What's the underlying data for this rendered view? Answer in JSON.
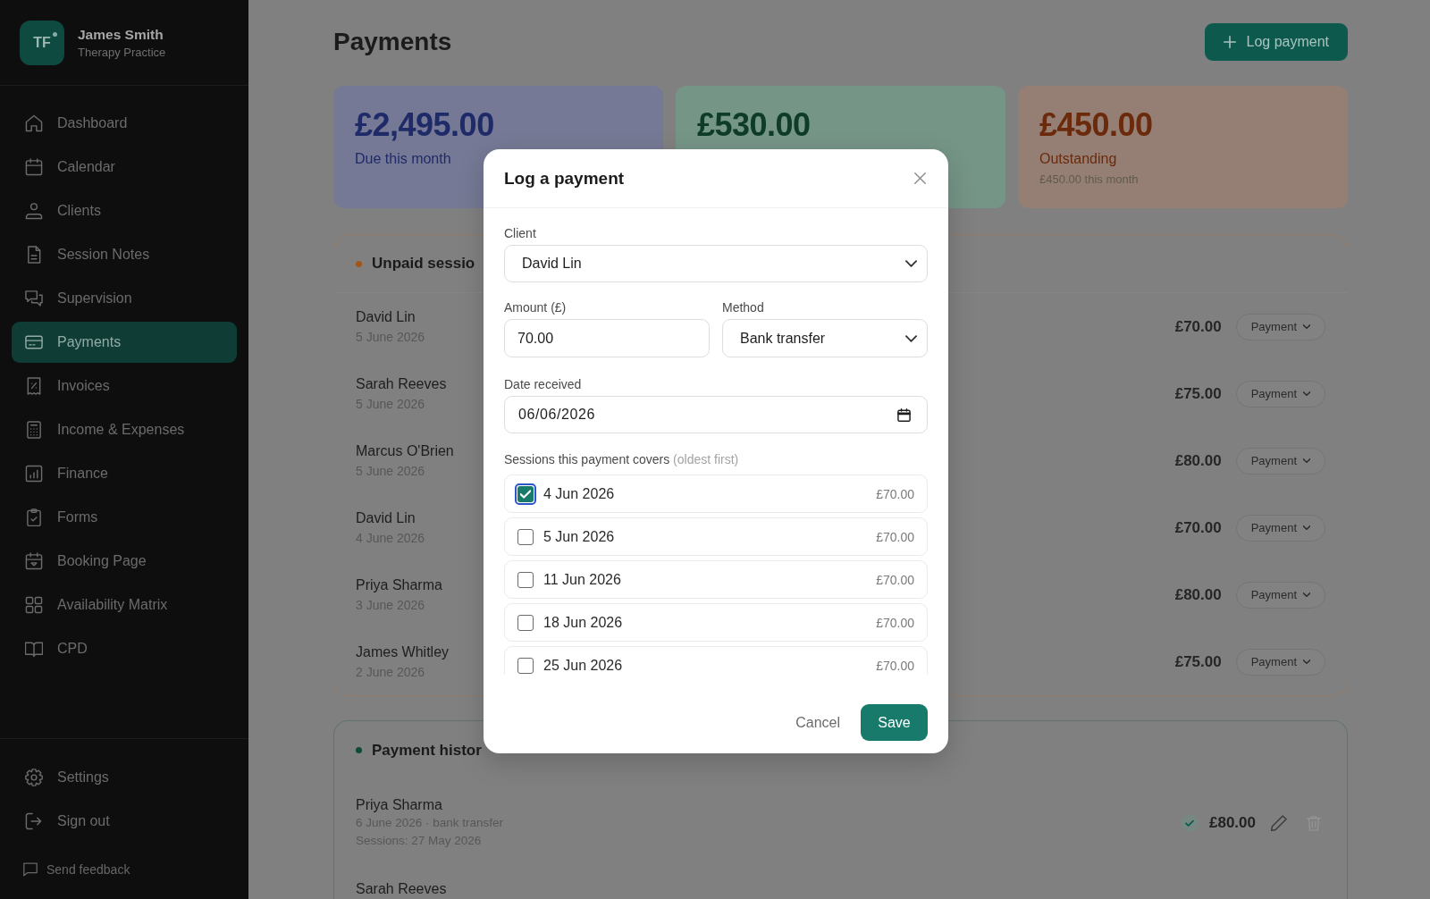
{
  "sidebar": {
    "brand": {
      "initials": "TF",
      "name": "James Smith",
      "subtitle": "Therapy Practice"
    },
    "nav": [
      {
        "label": "Dashboard",
        "selected": false
      },
      {
        "label": "Calendar",
        "selected": false
      },
      {
        "label": "Clients",
        "selected": false
      },
      {
        "label": "Session Notes",
        "selected": false
      },
      {
        "label": "Supervision",
        "selected": false
      },
      {
        "label": "Payments",
        "selected": true
      },
      {
        "label": "Invoices",
        "selected": false
      },
      {
        "label": "Income & Expenses",
        "selected": false
      },
      {
        "label": "Finance",
        "selected": false
      },
      {
        "label": "Forms",
        "selected": false
      },
      {
        "label": "Booking Page",
        "selected": false
      },
      {
        "label": "Availability Matrix",
        "selected": false
      },
      {
        "label": "CPD",
        "selected": false
      }
    ],
    "bottom_nav": [
      {
        "label": "Settings",
        "selected": false
      },
      {
        "label": "Sign out",
        "selected": false
      }
    ],
    "feedback": "Send feedback"
  },
  "header": {
    "title": "Payments",
    "action": "Log payment"
  },
  "summary_cards": [
    {
      "amount": "£2,495.00",
      "label": "Due this month",
      "color": "#1f2a68"
    },
    {
      "amount": "£530.00",
      "color": "#0e3c28"
    },
    {
      "amount": "£450.00",
      "label": "Outstanding",
      "note": "£450.00 this month",
      "color": "#6a2a0b"
    }
  ],
  "unpaid_sessions": {
    "title": "Unpaid sessio",
    "color": "#a0561a",
    "rows": [
      {
        "client": "David Lin",
        "date": "5 June 2026",
        "amount": "£70.00",
        "action": "Payment"
      },
      {
        "client": "Sarah Reeves",
        "date": "5 June 2026",
        "amount": "£75.00",
        "action": "Payment"
      },
      {
        "client": "Marcus O'Brien",
        "date": "5 June 2026",
        "amount": "£80.00",
        "action": "Payment"
      },
      {
        "client": "David Lin",
        "date": "4 June 2026",
        "amount": "£70.00",
        "action": "Payment"
      },
      {
        "client": "Priya Sharma",
        "date": "3 June 2026",
        "amount": "£80.00",
        "action": "Payment"
      },
      {
        "client": "James Whitley",
        "date": "2 June 2026",
        "amount": "£75.00",
        "action": "Payment"
      }
    ]
  },
  "payment_history": {
    "title": "Payment histor",
    "color": "#0e4a3a",
    "rows": [
      {
        "client": "Priya Sharma",
        "detail": "6 June 2026 · bank transfer",
        "sessions": "Sessions: 27 May 2026",
        "amount": "£80.00"
      },
      {
        "client": "Sarah Reeves"
      }
    ]
  },
  "dialog": {
    "title": "Log a payment",
    "client": {
      "label": "Client",
      "value": "David Lin"
    },
    "amount": {
      "label": "Amount (£)",
      "value": "70.00"
    },
    "method": {
      "label": "Method",
      "value": "Bank transfer"
    },
    "date_received": {
      "label": "Date received",
      "value": "06/06/2026"
    },
    "sessions": {
      "label": "Sessions this payment covers",
      "hint": "(oldest first)",
      "items": [
        {
          "date": "4 Jun 2026",
          "amount": "£70.00",
          "checked": true
        },
        {
          "date": "5 Jun 2026",
          "amount": "£70.00",
          "checked": false
        },
        {
          "date": "11 Jun 2026",
          "amount": "£70.00",
          "checked": false
        },
        {
          "date": "18 Jun 2026",
          "amount": "£70.00",
          "checked": false
        },
        {
          "date": "25 Jun 2026",
          "amount": "£70.00",
          "checked": false
        }
      ]
    },
    "buttons": {
      "cancel": "Cancel",
      "save": "Save"
    }
  }
}
